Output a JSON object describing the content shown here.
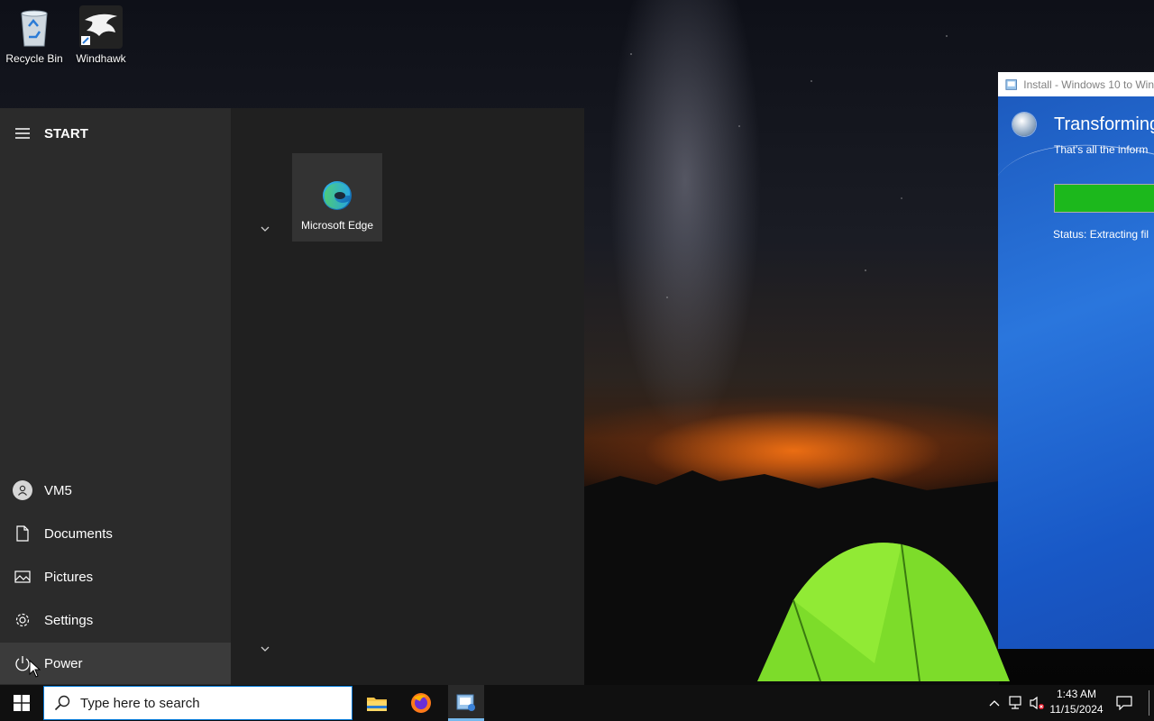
{
  "desktop": {
    "icons": [
      {
        "label": "Recycle Bin",
        "icon": "recycle-bin-icon"
      },
      {
        "label": "Windhawk",
        "icon": "windhawk-eagle-icon"
      }
    ]
  },
  "start_menu": {
    "title": "START",
    "left_items": [
      {
        "label": "VM5",
        "icon": "user-avatar-icon"
      },
      {
        "label": "Documents",
        "icon": "document-icon"
      },
      {
        "label": "Pictures",
        "icon": "pictures-icon"
      },
      {
        "label": "Settings",
        "icon": "gear-icon"
      },
      {
        "label": "Power",
        "icon": "power-icon"
      }
    ],
    "tiles": [
      {
        "label": "Microsoft Edge",
        "icon": "edge-icon"
      }
    ]
  },
  "installer": {
    "title": "Install - Windows 10 to Win",
    "heading": "Transforming",
    "subtext": "That's all the inform",
    "status": "Status: Extracting fil",
    "progress": 1.0,
    "progress_color": "#1cb81c"
  },
  "taskbar": {
    "search_placeholder": "Type here to search",
    "pinned": [
      {
        "name": "file-explorer",
        "icon": "folder-icon"
      },
      {
        "name": "firefox",
        "icon": "firefox-icon"
      },
      {
        "name": "installer",
        "icon": "installer-icon",
        "active": true
      }
    ],
    "clock_time": "1:43 AM",
    "clock_date": "11/15/2024",
    "accent_color": "#0078d7"
  }
}
